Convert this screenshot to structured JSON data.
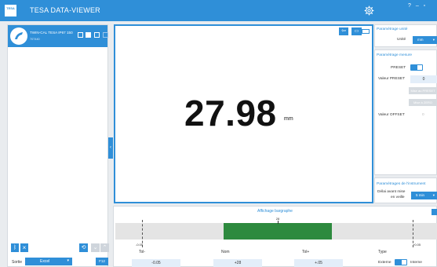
{
  "app": {
    "logo_text": "TESA",
    "title": "TESA DATA-VIEWER",
    "window_controls": "? – ▫"
  },
  "device": {
    "name": "TWIN-CAL TESA IP67 150",
    "sub": "707440"
  },
  "left_footer": {
    "bluetooth_icon": "bluetooth-icon",
    "output_label": "Sortie",
    "output_format": "Excel",
    "key_label": "F12"
  },
  "display": {
    "value": "27.98",
    "unit": "mm"
  },
  "settings": {
    "unit_section": "Paramétrage unité",
    "unit_label": "Unité",
    "unit_value": "mm",
    "measure_section": "Paramétrage mesure",
    "preset_label": "PRESET",
    "preset_value_label": "Valeur PRESET",
    "preset_value": "0",
    "set_preset_btn": "Mise au PRESET",
    "set_zero_btn": "Mise à ZERO",
    "offset_label": "Valeur OFFSET",
    "offset_value": "0",
    "instrument_section": "Paramétrages de l'instrument",
    "sleep_label_1": "Délai avant mise",
    "sleep_label_2": "en veille",
    "sleep_value": "5 min"
  },
  "bargraph": {
    "title": "Affichage bargraphe",
    "value": 28,
    "value_label": "28",
    "tol_minus_mark": "-0.05",
    "tol_plus_mark": "+0.05",
    "tol_minus_label": "Tol-",
    "nom_label": "Nom",
    "tol_plus_label": "Tol+",
    "type_label": "Type",
    "tol_minus_value": "-0.05",
    "nom_value": "+28",
    "tol_plus_value": "+.05",
    "type_external": "Externe",
    "type_internal": "Interne"
  }
}
